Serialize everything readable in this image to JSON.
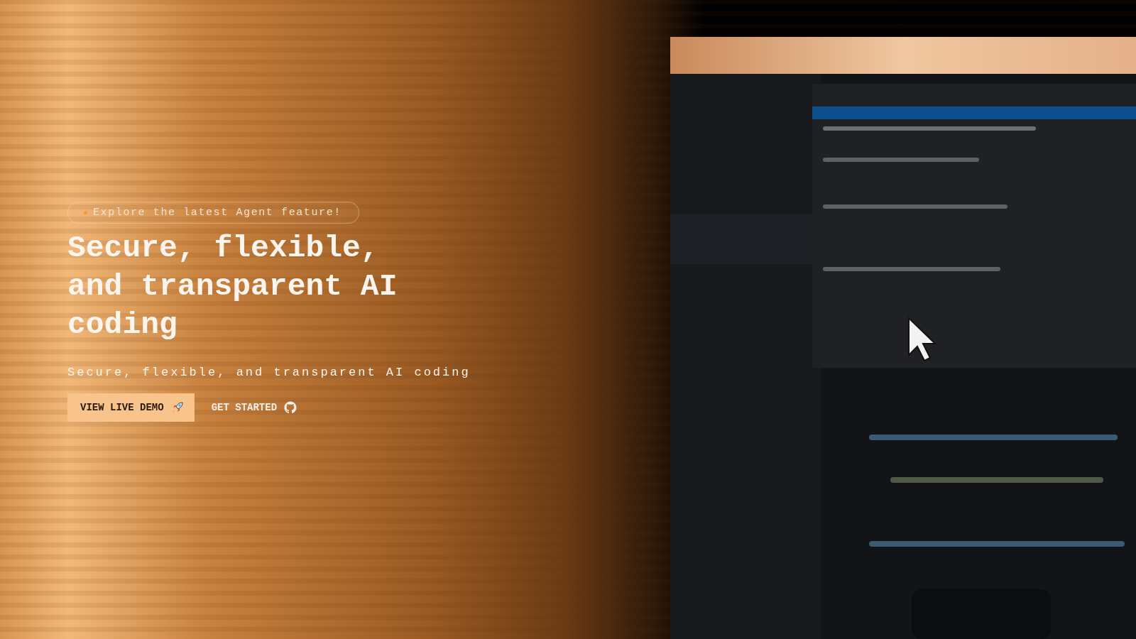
{
  "hero": {
    "badge": {
      "text": "Explore the latest Agent feature!"
    },
    "headline": "Secure, flexible, and transparent AI coding",
    "subtitle": "Secure, flexible, and transparent AI coding",
    "buttons": [
      {
        "label": "VIEW LIVE DEMO",
        "kind": "primary"
      },
      {
        "label": "GET STARTED",
        "kind": "secondary"
      }
    ]
  }
}
